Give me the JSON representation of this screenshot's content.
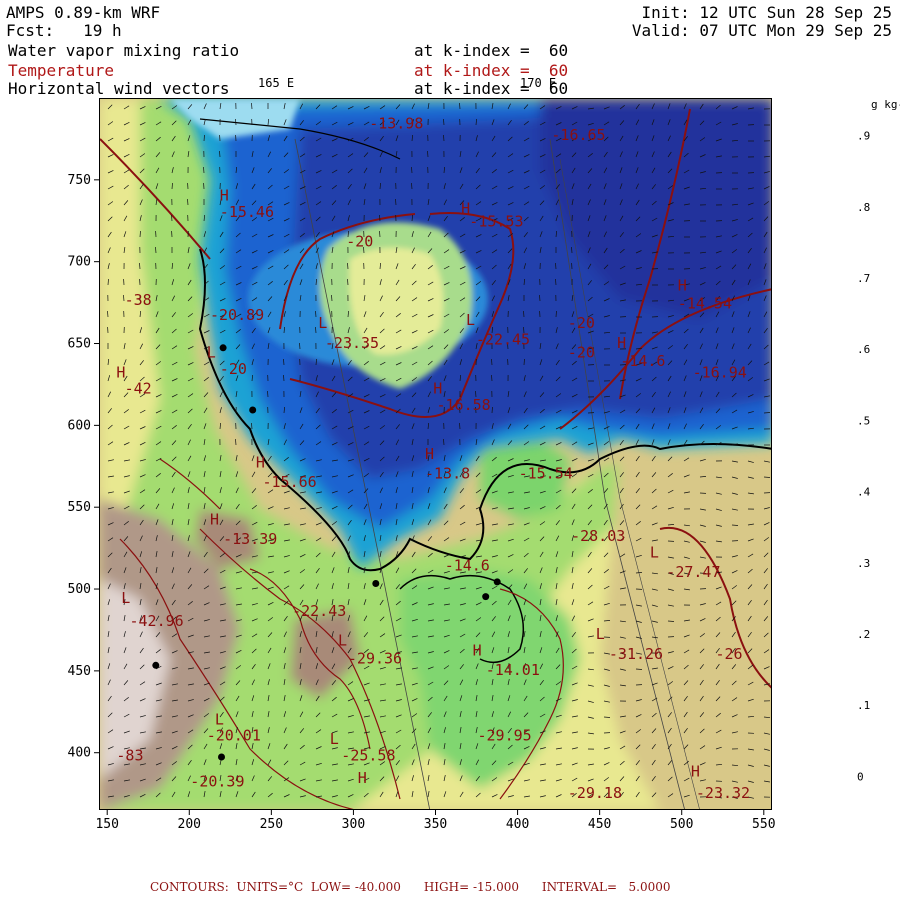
{
  "header": {
    "model": "AMPS 0.89-km WRF",
    "fcst_label": "Fcst:",
    "fcst_value": "19 h",
    "init": "Init: 12 UTC Sun 28 Sep 25",
    "valid": "Valid: 07 UTC Mon 29 Sep 25",
    "field1": "Water vapor mixing ratio",
    "field1_level": "at k-index =  60",
    "field2": "Temperature",
    "field2_level": "at k-index =  60",
    "field3": "Horizontal wind vectors",
    "field3_level": "at k-index =  60"
  },
  "map": {
    "meridian_labels": [
      "165 E",
      "170 E"
    ],
    "x_ticks": [
      150,
      200,
      250,
      300,
      350,
      400,
      450,
      500,
      550
    ],
    "y_ticks": [
      400,
      450,
      500,
      550,
      600,
      650,
      700,
      750
    ],
    "x_range": [
      145,
      555
    ],
    "y_range": [
      365,
      800
    ],
    "contour_labels": [
      {
        "text": "-13.98",
        "x": 309,
        "y": 782
      },
      {
        "text": "-16.65",
        "x": 420,
        "y": 775
      },
      {
        "text": "H",
        "x": 218,
        "y": 738
      },
      {
        "text": "-15.46",
        "x": 218,
        "y": 728
      },
      {
        "text": "H",
        "x": 365,
        "y": 730
      },
      {
        "text": "-15.53",
        "x": 370,
        "y": 722
      },
      {
        "text": "-20",
        "x": 295,
        "y": 710
      },
      {
        "text": "H",
        "x": 497,
        "y": 683
      },
      {
        "text": "-14.54",
        "x": 497,
        "y": 672
      },
      {
        "text": "-38",
        "x": 160,
        "y": 674
      },
      {
        "text": "-20.89",
        "x": 212,
        "y": 665
      },
      {
        "text": "L",
        "x": 278,
        "y": 660
      },
      {
        "text": "-23.35",
        "x": 282,
        "y": 648
      },
      {
        "text": "L",
        "x": 368,
        "y": 662
      },
      {
        "text": "-22.45",
        "x": 374,
        "y": 650
      },
      {
        "text": "-20",
        "x": 430,
        "y": 660
      },
      {
        "text": "-20",
        "x": 430,
        "y": 642
      },
      {
        "text": "H",
        "x": 460,
        "y": 648
      },
      {
        "text": "-14.6",
        "x": 462,
        "y": 637
      },
      {
        "text": "-16.94",
        "x": 506,
        "y": 630
      },
      {
        "text": "H",
        "x": 155,
        "y": 630
      },
      {
        "text": "-42",
        "x": 160,
        "y": 620
      },
      {
        "text": "L",
        "x": 210,
        "y": 642
      },
      {
        "text": "-20",
        "x": 218,
        "y": 632
      },
      {
        "text": "H",
        "x": 348,
        "y": 620
      },
      {
        "text": "-16.58",
        "x": 350,
        "y": 610
      },
      {
        "text": "H",
        "x": 240,
        "y": 575
      },
      {
        "text": "-15.66",
        "x": 244,
        "y": 563
      },
      {
        "text": "H",
        "x": 343,
        "y": 580
      },
      {
        "text": "-13.8",
        "x": 343,
        "y": 568
      },
      {
        "text": "-15.54",
        "x": 400,
        "y": 568
      },
      {
        "text": "H",
        "x": 212,
        "y": 540
      },
      {
        "text": "-13.39",
        "x": 220,
        "y": 528
      },
      {
        "text": "-28.03",
        "x": 432,
        "y": 530
      },
      {
        "text": "L",
        "x": 480,
        "y": 520
      },
      {
        "text": "-27.47",
        "x": 490,
        "y": 508
      },
      {
        "text": "-14.6",
        "x": 355,
        "y": 512
      },
      {
        "text": "-22.43",
        "x": 262,
        "y": 484
      },
      {
        "text": "L",
        "x": 158,
        "y": 492
      },
      {
        "text": "-42.96",
        "x": 163,
        "y": 478
      },
      {
        "text": "L",
        "x": 290,
        "y": 466
      },
      {
        "text": "-29.36",
        "x": 296,
        "y": 455
      },
      {
        "text": "L",
        "x": 447,
        "y": 470
      },
      {
        "text": "-31.26",
        "x": 455,
        "y": 458
      },
      {
        "text": "-26",
        "x": 520,
        "y": 458
      },
      {
        "text": "H",
        "x": 372,
        "y": 460
      },
      {
        "text": "-14.01",
        "x": 380,
        "y": 448
      },
      {
        "text": "L",
        "x": 215,
        "y": 418
      },
      {
        "text": "-20.01",
        "x": 210,
        "y": 408
      },
      {
        "text": "L",
        "x": 285,
        "y": 406
      },
      {
        "text": "-25.58",
        "x": 292,
        "y": 396
      },
      {
        "text": "-29.95",
        "x": 375,
        "y": 408
      },
      {
        "text": "-83",
        "x": 155,
        "y": 396
      },
      {
        "text": "H",
        "x": 302,
        "y": 382
      },
      {
        "text": "-20.39",
        "x": 200,
        "y": 380
      },
      {
        "text": "-29.18",
        "x": 430,
        "y": 373
      },
      {
        "text": "H",
        "x": 505,
        "y": 386
      },
      {
        "text": "-23.32",
        "x": 508,
        "y": 373
      }
    ],
    "stations": [
      {
        "x": 220,
        "y": 648
      },
      {
        "x": 238,
        "y": 610
      },
      {
        "x": 313,
        "y": 504
      },
      {
        "x": 380,
        "y": 496
      },
      {
        "x": 387,
        "y": 505
      },
      {
        "x": 179,
        "y": 454
      },
      {
        "x": 219,
        "y": 398
      }
    ]
  },
  "colorbar": {
    "unit": "g kg-1",
    "labels": [
      "0",
      ".1",
      ".2",
      ".3",
      ".4",
      ".5",
      ".6",
      ".7",
      ".8",
      ".9"
    ],
    "colors": [
      "#ffffff",
      "#e0d8d8",
      "#a08878",
      "#c8b888",
      "#e2dc9a",
      "#f2f69a",
      "#c2e880",
      "#7ed46c",
      "#3cc468",
      "#1aa898",
      "#0fb0d8",
      "#1890e8",
      "#1e72d8",
      "#1e58c4",
      "#1e48b4",
      "#2038a0"
    ]
  },
  "footer": {
    "contours_label": "CONTOURS:",
    "units": "UNITS=°C",
    "low": "LOW= -40.000",
    "high": "HIGH= -15.000",
    "interval": "INTERVAL=   5.0000"
  }
}
